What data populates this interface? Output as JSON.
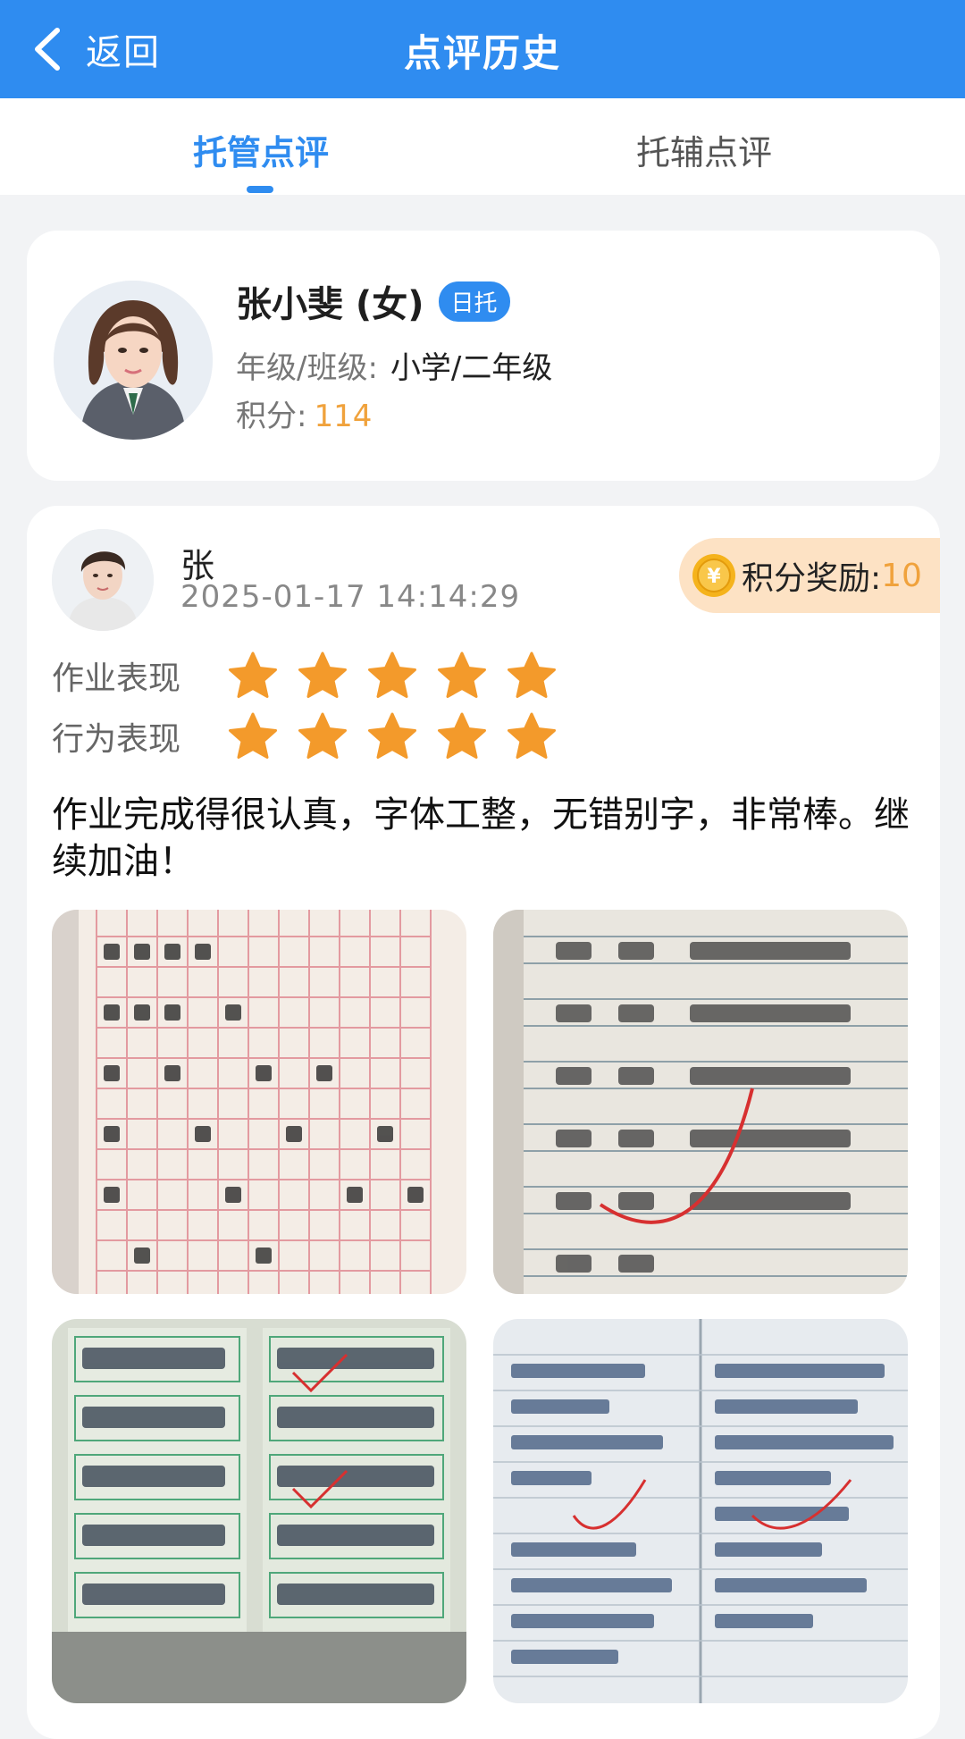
{
  "header": {
    "back_label": "返回",
    "title": "点评历史"
  },
  "tabs": [
    {
      "label": "托管点评",
      "active": true
    },
    {
      "label": "托辅点评",
      "active": false
    }
  ],
  "student": {
    "name": "张小斐 (女)",
    "badge": "日托",
    "grade_label": "年级/班级:",
    "grade_value": "小学/二年级",
    "score_label": "积分:",
    "score_value": "114"
  },
  "review": {
    "teacher_name": "张",
    "time": "2025-01-17 14:14:29",
    "reward_label": "积分奖励:",
    "reward_value": "10",
    "ratings": [
      {
        "label": "作业表现",
        "stars": 5,
        "max": 5
      },
      {
        "label": "行为表现",
        "stars": 5,
        "max": 5
      }
    ],
    "comment": "作业完成得很认真，字体工整，无错别字，非常棒。继续加油！"
  },
  "colors": {
    "primary": "#2f8cf0",
    "star": "#f39a2b",
    "score": "#f0a23c",
    "reward_bg": "#fde2c4"
  },
  "icons": {
    "back": "chevron-left-icon",
    "coin": "yen-coin-icon",
    "star": "star-icon"
  }
}
